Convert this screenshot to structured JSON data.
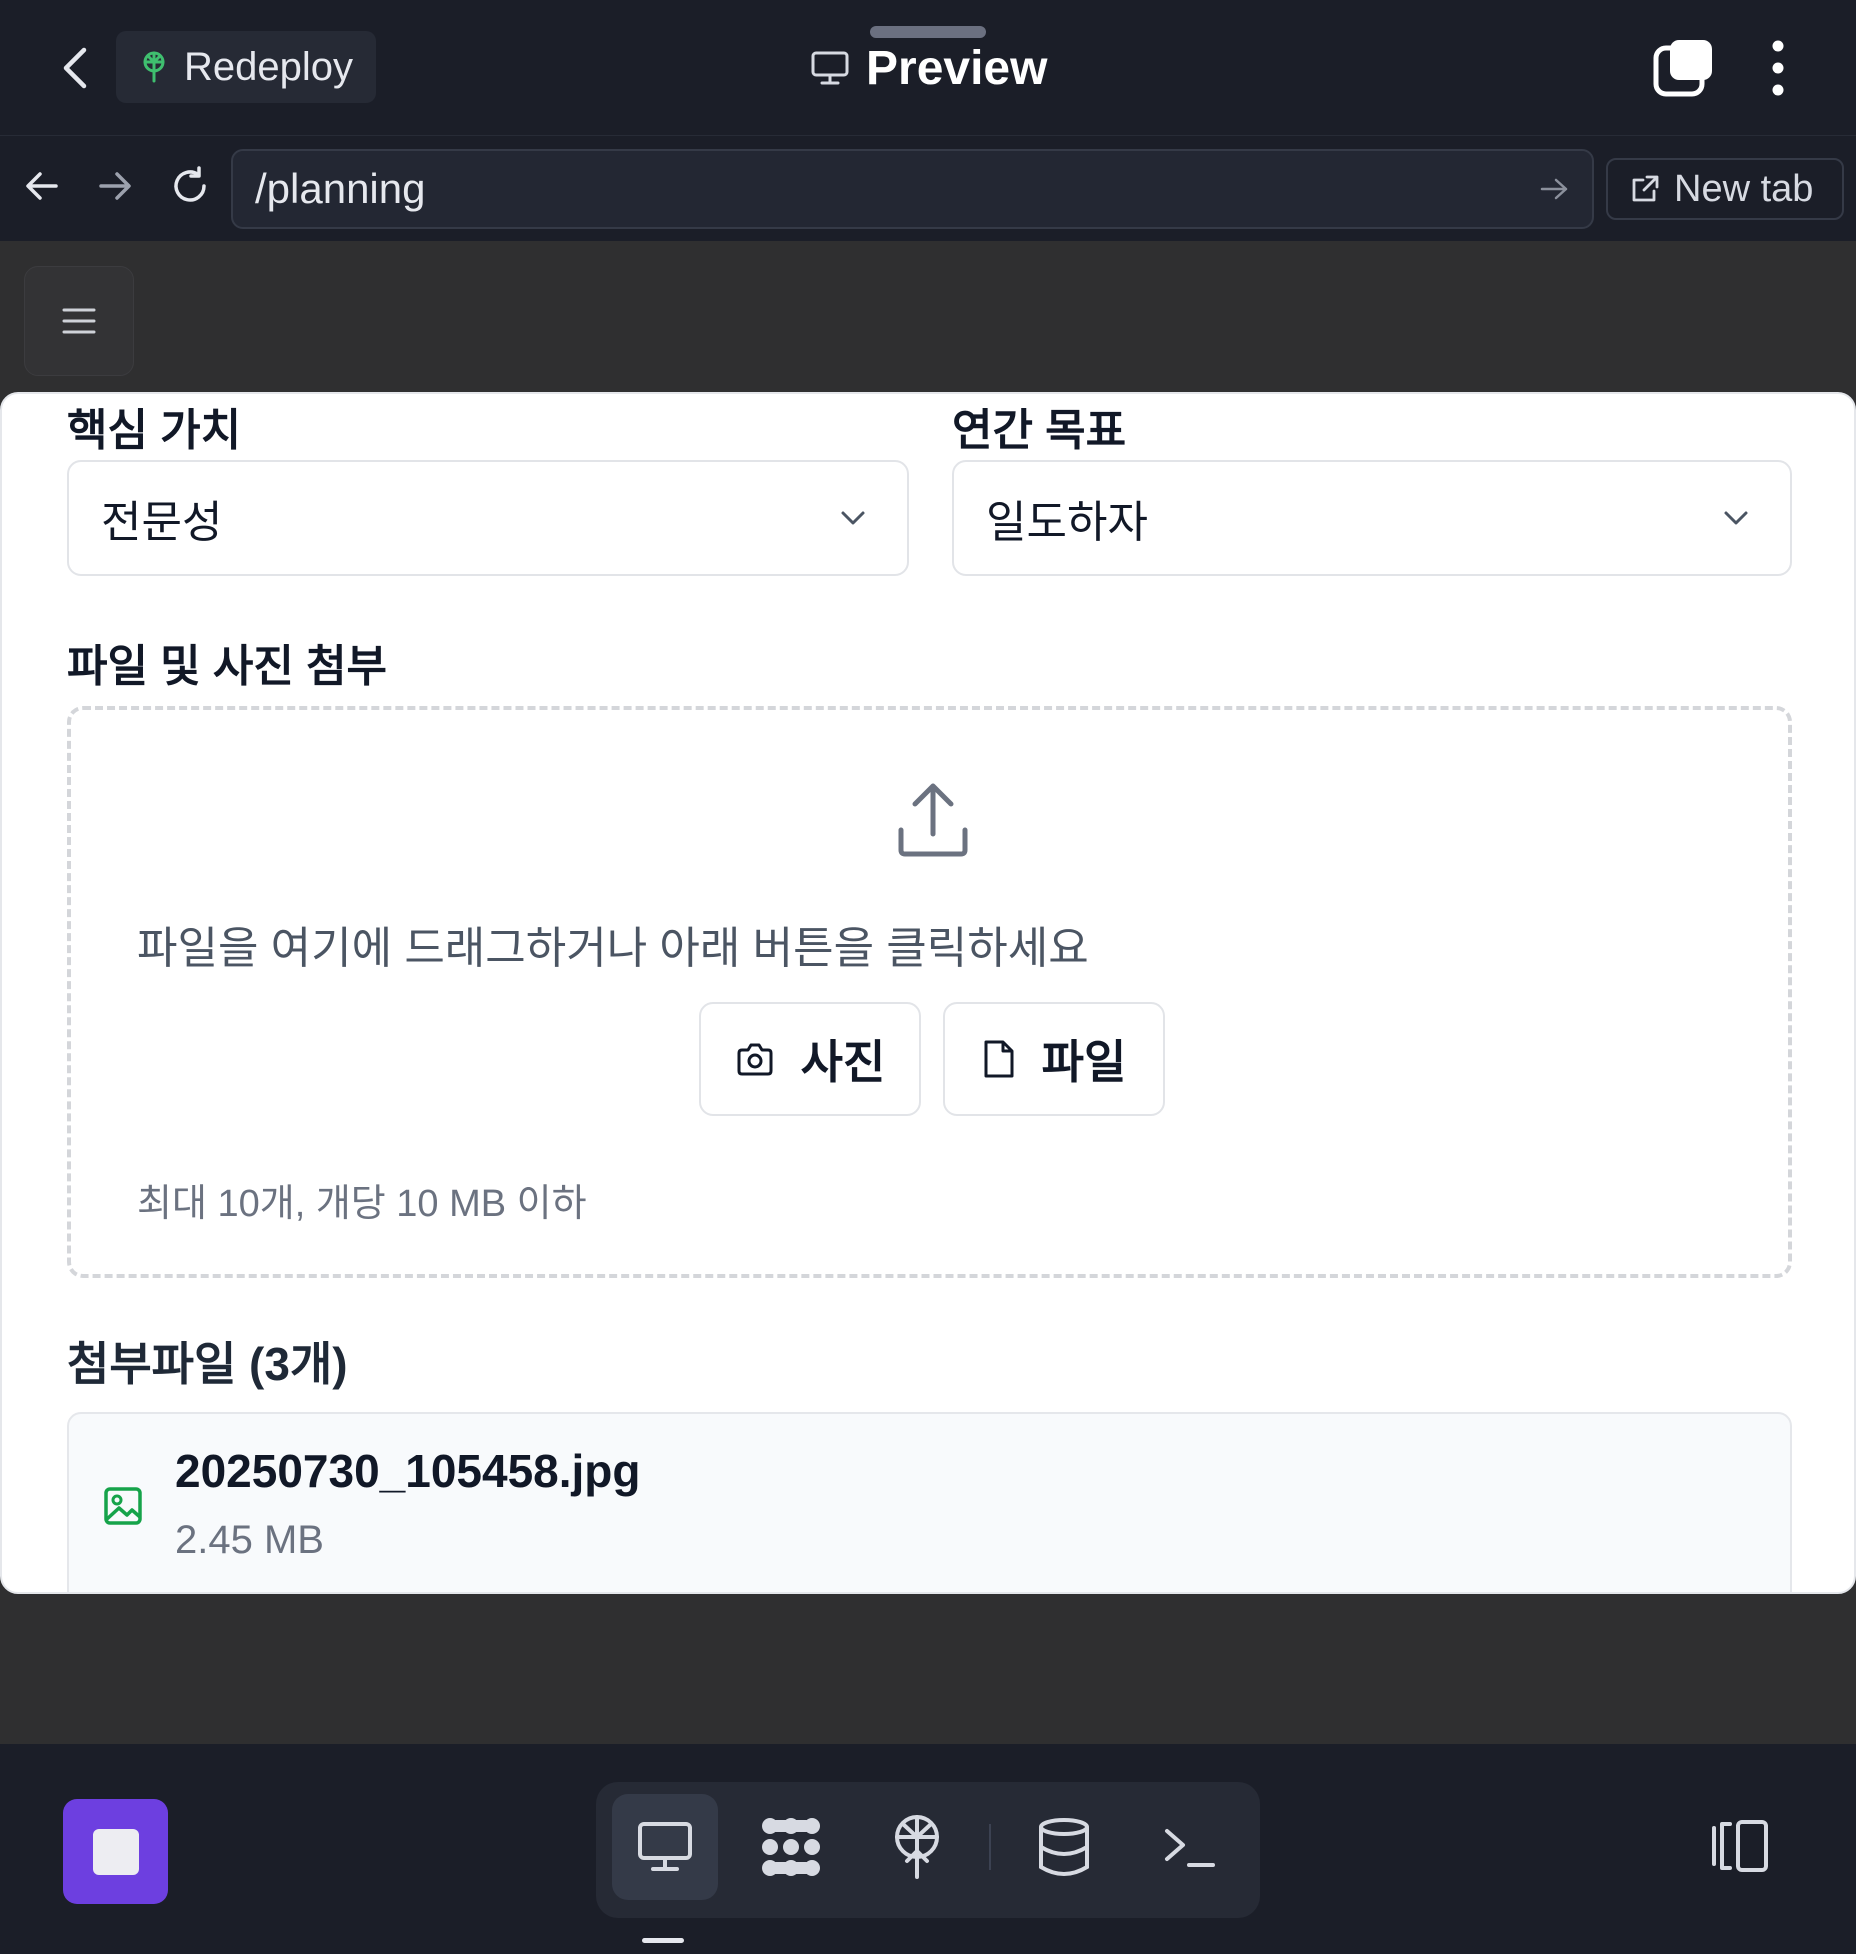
{
  "topbar": {
    "redeploy_label": "Redeploy",
    "title": "Preview"
  },
  "urlbar": {
    "url": "/planning",
    "new_tab_label": "New tab"
  },
  "form": {
    "core_value": {
      "label": "핵심 가치",
      "selected": "전문성"
    },
    "annual_goal": {
      "label": "연간 목표",
      "selected": "일도하자"
    }
  },
  "attach": {
    "section_label": "파일 및 사진 첨부",
    "drop_text": "파일을 여기에 드래그하거나 아래 버튼을 클릭하세요",
    "photo_button": "사진",
    "file_button": "파일",
    "limit_text": "최대 10개, 개당 10 MB 이하"
  },
  "attachments": {
    "title": "첨부파일 (3개)",
    "items": [
      {
        "name": "20250730_105458.jpg",
        "size": "2.45 MB"
      }
    ]
  },
  "colors": {
    "bar_bg": "#1b1e28",
    "accent_purple": "#6d3fe0",
    "redeploy_green": "#3fbf6f",
    "file_icon_green": "#16a34a"
  },
  "icons": {
    "back": "chevron-left-icon",
    "redeploy": "deploy-tree-icon",
    "preview": "monitor-icon",
    "copy": "copy-icon",
    "more": "more-vertical-icon"
  }
}
